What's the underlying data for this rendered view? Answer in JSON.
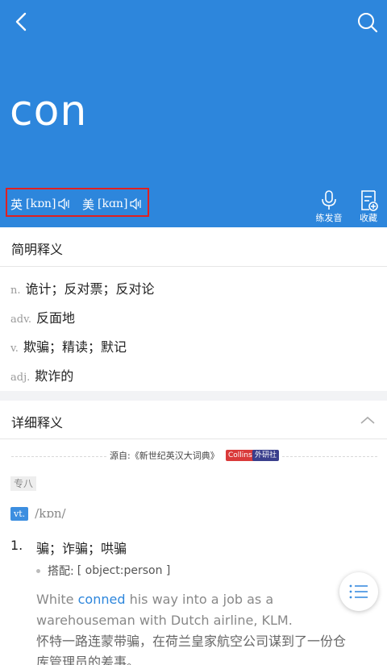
{
  "header": {
    "word": "con",
    "phonetics": [
      {
        "lang": "英",
        "ipa": "[kɒn]"
      },
      {
        "lang": "美",
        "ipa": "[kɑn]"
      }
    ],
    "tools": {
      "mic_label": "练发音",
      "fav_label": "收藏"
    }
  },
  "brief": {
    "title": "简明释义",
    "definitions": [
      {
        "pos": "n.",
        "meaning": "诡计；反对票；反对论"
      },
      {
        "pos": "adv.",
        "meaning": "反面地"
      },
      {
        "pos": "v.",
        "meaning": "欺骗；精读；默记"
      },
      {
        "pos": "adj.",
        "meaning": "欺诈的"
      }
    ]
  },
  "detail": {
    "title": "详细释义",
    "source": "源自:《新世纪英汉大词典》",
    "badges": [
      "Collins",
      "外研社"
    ],
    "tag": "专八",
    "pos": "vt.",
    "ipa": "/kɒn/",
    "senses": [
      {
        "num": "1.",
        "meaning": "骗；诈骗；哄骗",
        "collocation_label": "搭配:",
        "collocation": "[ object:person ]",
        "example_en_before": "White ",
        "example_en_highlight": "conned",
        "example_en_after": " his way into a job as a warehouseman with Dutch airline, KLM.",
        "example_cn": "怀特一路连蒙带骗，在荷兰皇家航空公司谋到了一份仓库管理员的差事。"
      }
    ]
  },
  "colors": {
    "header_bg": "#2d86dc",
    "highlight": "#d93a3a",
    "link": "#2d86dc"
  }
}
